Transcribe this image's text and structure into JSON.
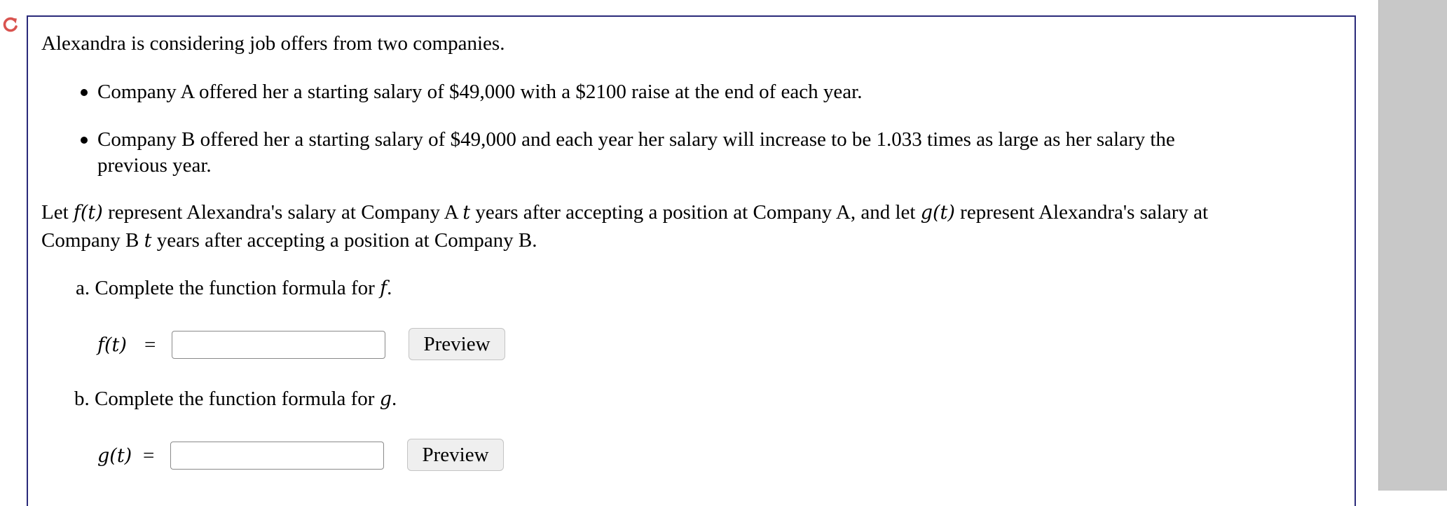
{
  "reload_icon": {
    "name": "reload-icon",
    "color": "#d9534f"
  },
  "problem": {
    "intro": "Alexandra is considering job offers from two companies.",
    "bullets": [
      {
        "line1": "Company A offered her a starting salary of $49,000 with a $2100 raise at the end of each year."
      },
      {
        "line1": "Company B offered her a starting salary of $49,000 and each year her salary will increase to be 1.033 times as large as her salary the",
        "line2": "previous year."
      }
    ],
    "let_para": {
      "p1": "Let ",
      "f_t": "f(t)",
      "p2": " represent Alexandra's salary at Company A ",
      "t1": "t",
      "p3": " years after accepting a position at Company A, and let ",
      "g_t": "g(t)",
      "p4": " represent Alexandra's salary at",
      "p5": "Company B ",
      "t2": "t",
      "p6": " years after accepting a position at Company B."
    }
  },
  "part_a": {
    "prompt": "a. Complete the function formula for ",
    "var": "f",
    "period": ".",
    "lhs": "f(t)",
    "eq": "=",
    "input_value": "",
    "preview_label": "Preview"
  },
  "part_b": {
    "prompt": "b. Complete the function formula for ",
    "var": "g",
    "period": ".",
    "lhs": "g(t)",
    "eq": "=",
    "input_value": "",
    "preview_label": "Preview"
  }
}
